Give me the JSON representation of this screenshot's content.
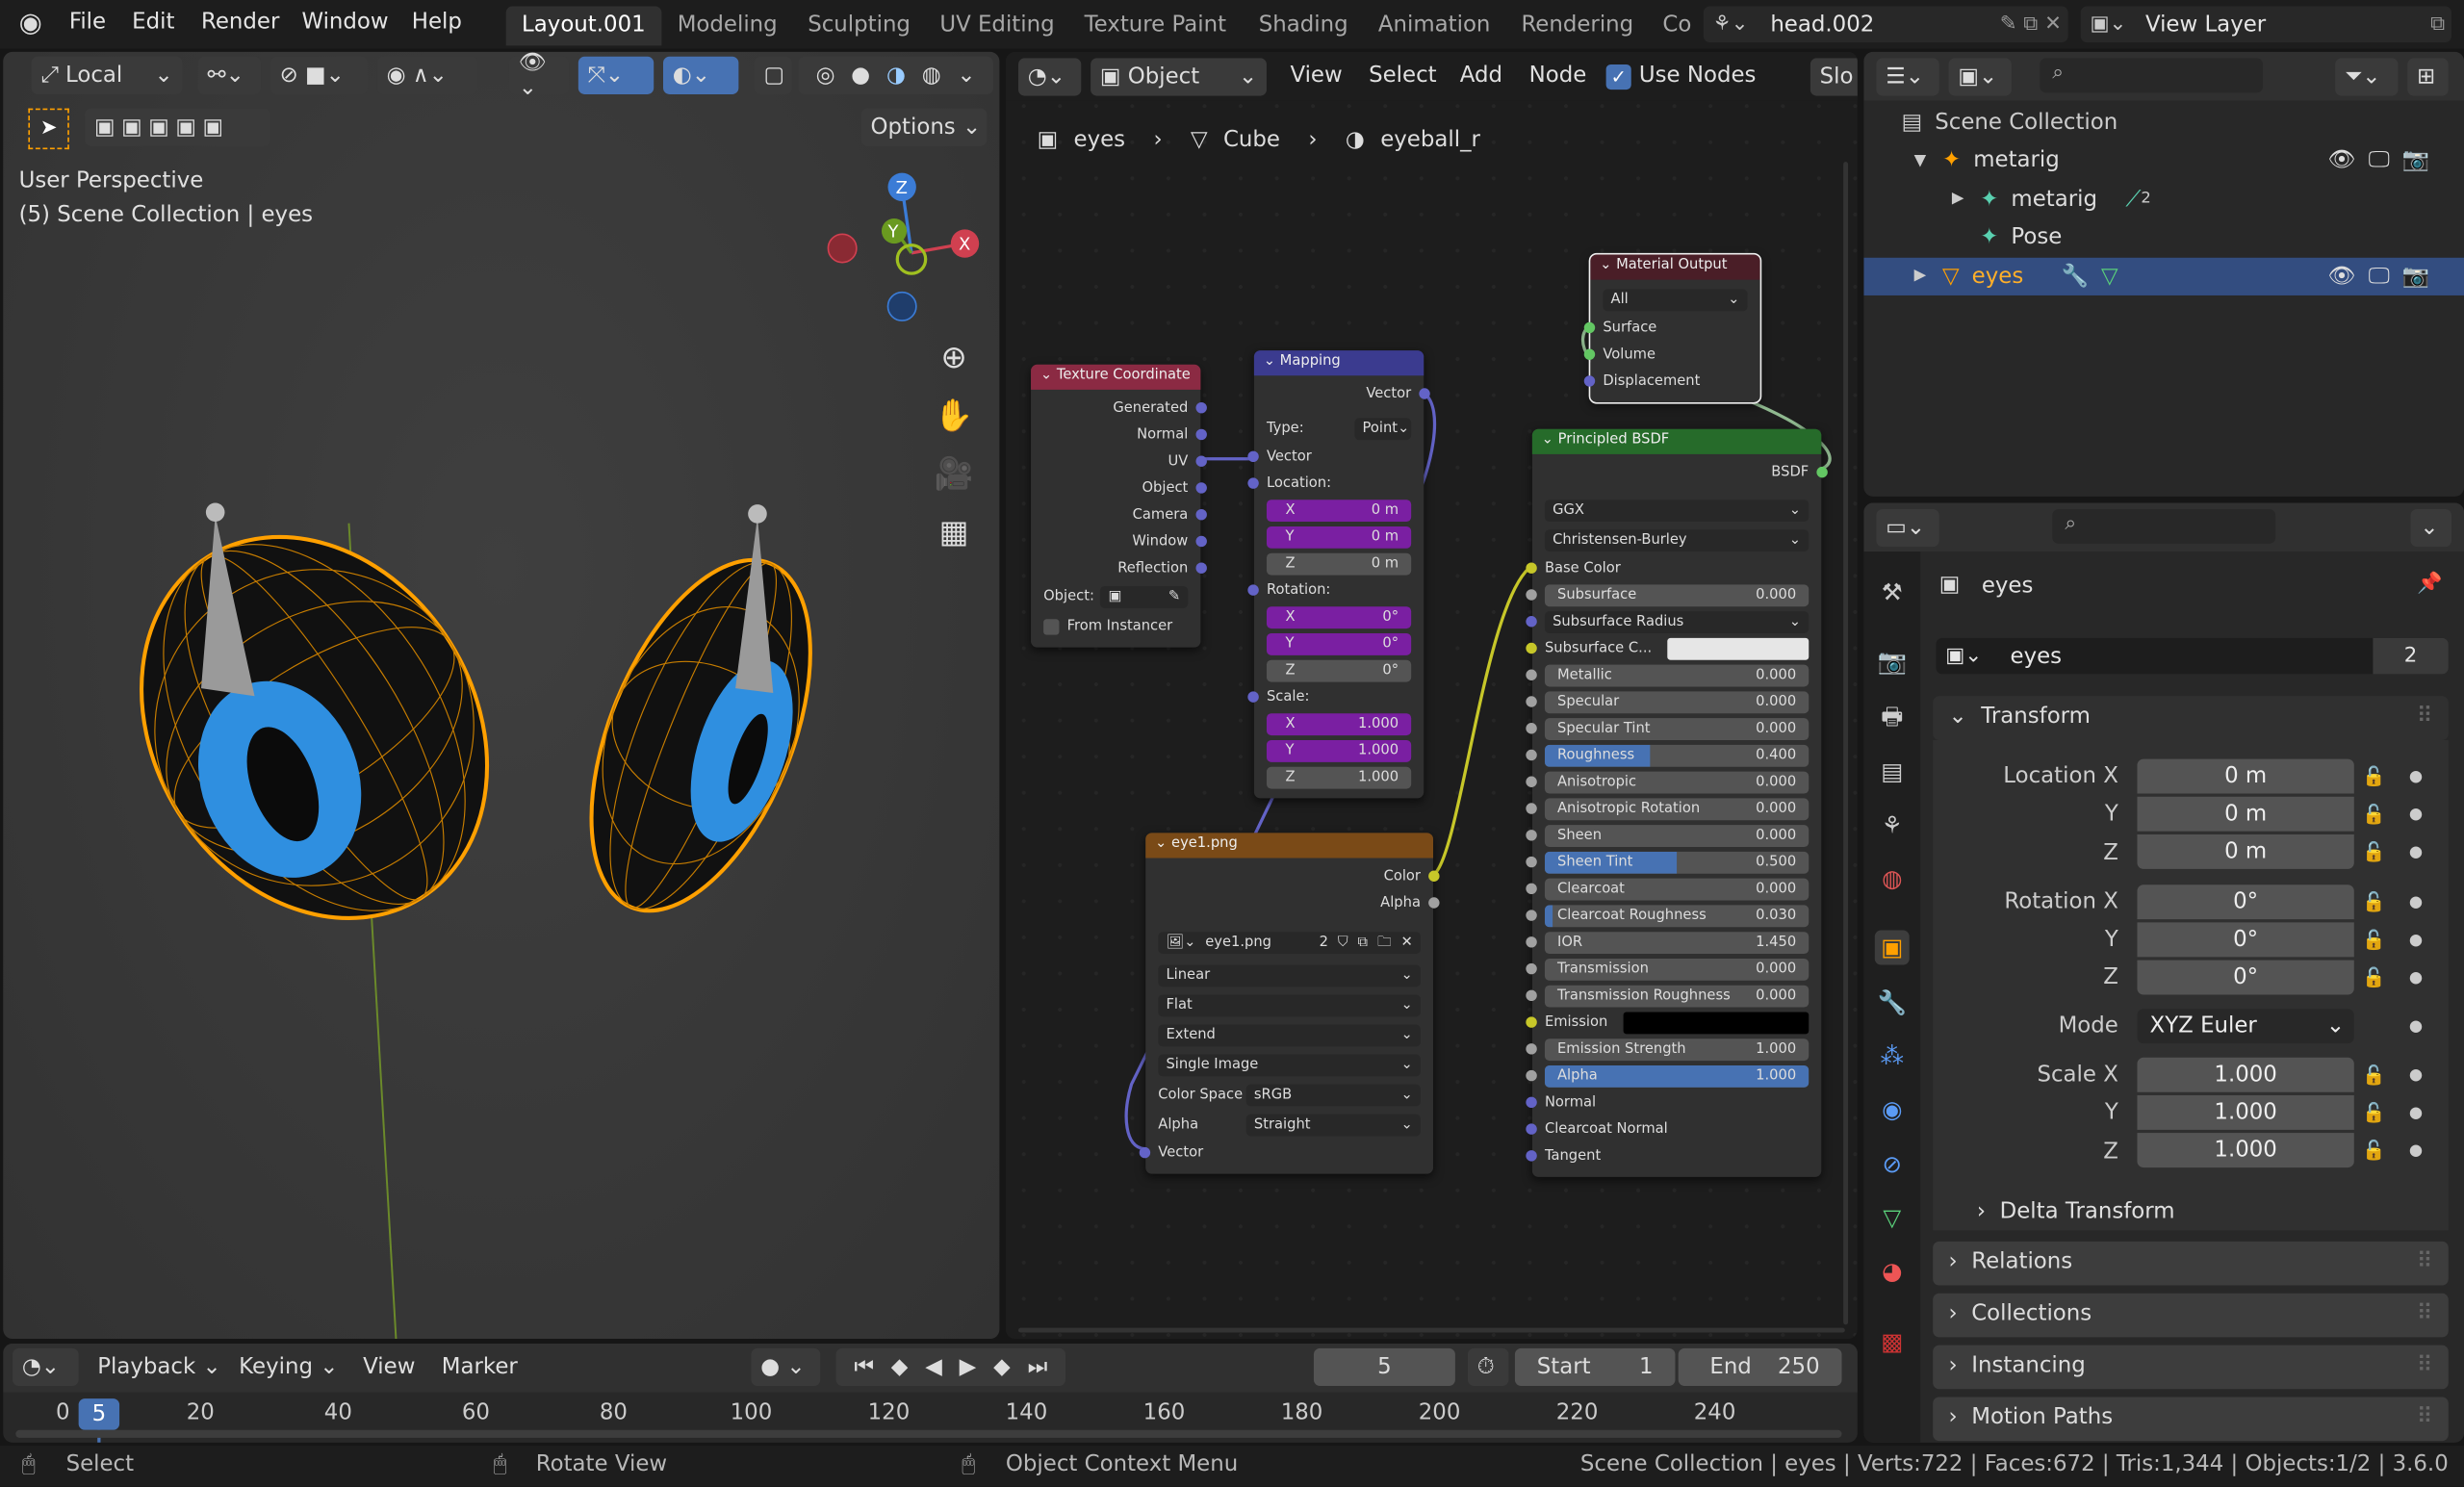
{
  "topbar": {
    "menus": [
      "File",
      "Edit",
      "Render",
      "Window",
      "Help"
    ],
    "workspaces": [
      "Layout.001",
      "Modeling",
      "Sculpting",
      "UV Editing",
      "Texture Paint",
      "Shading",
      "Animation",
      "Rendering",
      "Co"
    ],
    "active_workspace": "Layout.001",
    "scene": "head.002",
    "view_layer": "View Layer"
  },
  "viewport": {
    "orientation": "Local",
    "options": "Options",
    "view_name": "User Perspective",
    "context": "(5) Scene Collection | eyes",
    "gizmo": {
      "x": "X",
      "y": "Y",
      "z": "Z"
    }
  },
  "node_editor": {
    "object_mode": "Object",
    "menus": [
      "View",
      "Select",
      "Add",
      "Node"
    ],
    "use_nodes": "Use Nodes",
    "use_nodes_checked": true,
    "slot": "Slo",
    "breadcrumb": [
      "eyes",
      "Cube",
      "eyeball_r"
    ]
  },
  "nodes": {
    "texcoord": {
      "title": "Texture Coordinate",
      "color": "#8b2a43",
      "rows": [
        {
          "t": "out",
          "label": "Generated",
          "s": "#6363c7"
        },
        {
          "t": "out",
          "label": "Normal",
          "s": "#6363c7"
        },
        {
          "t": "out",
          "label": "UV",
          "s": "#6363c7"
        },
        {
          "t": "out",
          "label": "Object",
          "s": "#6363c7"
        },
        {
          "t": "out",
          "label": "Camera",
          "s": "#6363c7"
        },
        {
          "t": "out",
          "label": "Window",
          "s": "#6363c7"
        },
        {
          "t": "out",
          "label": "Reflection",
          "s": "#6363c7"
        },
        {
          "t": "objfield",
          "label": "Object:"
        },
        {
          "t": "check",
          "label": "From Instancer"
        }
      ]
    },
    "mapping": {
      "title": "Mapping",
      "color": "#3b3b8f",
      "rows": [
        {
          "t": "out",
          "label": "Vector",
          "s": "#6363c7"
        },
        {
          "t": "propsel",
          "label": "Type:",
          "value": "Point"
        },
        {
          "t": "in",
          "label": "Vector",
          "s": "#6363c7"
        },
        {
          "t": "in",
          "label": "Location:",
          "s": "#6363c7"
        },
        {
          "t": "vec",
          "label": "X",
          "value": "0 m"
        },
        {
          "t": "vec",
          "label": "Y",
          "value": "0 m"
        },
        {
          "t": "vecg",
          "label": "Z",
          "value": "0 m"
        },
        {
          "t": "in",
          "label": "Rotation:",
          "s": "#6363c7"
        },
        {
          "t": "vec",
          "label": "X",
          "value": "0°"
        },
        {
          "t": "vec",
          "label": "Y",
          "value": "0°"
        },
        {
          "t": "vecg",
          "label": "Z",
          "value": "0°"
        },
        {
          "t": "in",
          "label": "Scale:",
          "s": "#6363c7"
        },
        {
          "t": "vec",
          "label": "X",
          "value": "1.000"
        },
        {
          "t": "vec",
          "label": "Y",
          "value": "1.000"
        },
        {
          "t": "vecg",
          "label": "Z",
          "value": "1.000"
        }
      ]
    },
    "output": {
      "title": "Material Output",
      "color": "#4a1e27",
      "rows": [
        {
          "t": "sel",
          "value": "All"
        },
        {
          "t": "in",
          "label": "Surface",
          "s": "#63c763"
        },
        {
          "t": "in",
          "label": "Volume",
          "s": "#63c763"
        },
        {
          "t": "in",
          "label": "Displacement",
          "s": "#6363c7"
        }
      ]
    },
    "bsdf": {
      "title": "Principled BSDF",
      "color": "#266b2a",
      "rows": [
        {
          "t": "out",
          "label": "BSDF",
          "s": "#63c763"
        },
        {
          "t": "sel",
          "value": "GGX"
        },
        {
          "t": "sel",
          "value": "Christensen-Burley"
        },
        {
          "t": "in",
          "label": "Base Color",
          "s": "#c7c729"
        },
        {
          "t": "slider",
          "label": "Subsurface",
          "value": "0.000",
          "f": 0,
          "s": "#a1a1a1"
        },
        {
          "t": "selin",
          "label": "Subsurface Radius",
          "s": "#6363c7"
        },
        {
          "t": "color",
          "label": "Subsurface C...",
          "color": "#e6e6e6",
          "s": "#c7c729"
        },
        {
          "t": "slider",
          "label": "Metallic",
          "value": "0.000",
          "f": 0,
          "s": "#a1a1a1"
        },
        {
          "t": "slider",
          "label": "Specular",
          "value": "0.000",
          "f": 0,
          "s": "#a1a1a1"
        },
        {
          "t": "slider",
          "label": "Specular Tint",
          "value": "0.000",
          "f": 0,
          "s": "#a1a1a1"
        },
        {
          "t": "slider",
          "label": "Roughness",
          "value": "0.400",
          "f": 0.4,
          "s": "#a1a1a1"
        },
        {
          "t": "slider",
          "label": "Anisotropic",
          "value": "0.000",
          "f": 0,
          "s": "#a1a1a1"
        },
        {
          "t": "slider",
          "label": "Anisotropic Rotation",
          "value": "0.000",
          "f": 0,
          "s": "#a1a1a1"
        },
        {
          "t": "slider",
          "label": "Sheen",
          "value": "0.000",
          "f": 0,
          "s": "#a1a1a1"
        },
        {
          "t": "slider",
          "label": "Sheen Tint",
          "value": "0.500",
          "f": 0.5,
          "s": "#a1a1a1"
        },
        {
          "t": "slider",
          "label": "Clearcoat",
          "value": "0.000",
          "f": 0,
          "s": "#a1a1a1"
        },
        {
          "t": "slider",
          "label": "Clearcoat Roughness",
          "value": "0.030",
          "f": 0.03,
          "s": "#a1a1a1"
        },
        {
          "t": "slider",
          "label": "IOR",
          "value": "1.450",
          "f": 0,
          "s": "#a1a1a1"
        },
        {
          "t": "slider",
          "label": "Transmission",
          "value": "0.000",
          "f": 0,
          "s": "#a1a1a1"
        },
        {
          "t": "slider",
          "label": "Transmission Roughness",
          "value": "0.000",
          "f": 0,
          "s": "#a1a1a1"
        },
        {
          "t": "color",
          "label": "Emission",
          "color": "#000000",
          "s": "#c7c729"
        },
        {
          "t": "slider",
          "label": "Emission Strength",
          "value": "1.000",
          "f": 0,
          "s": "#a1a1a1"
        },
        {
          "t": "slider",
          "label": "Alpha",
          "value": "1.000",
          "f": 1,
          "s": "#a1a1a1"
        },
        {
          "t": "in",
          "label": "Normal",
          "s": "#6363c7"
        },
        {
          "t": "in",
          "label": "Clearcoat Normal",
          "s": "#6363c7"
        },
        {
          "t": "in",
          "label": "Tangent",
          "s": "#6363c7"
        }
      ]
    },
    "image": {
      "title": "eye1.png",
      "color": "#7a4a17",
      "rows": [
        {
          "t": "out",
          "label": "Color",
          "s": "#c7c729"
        },
        {
          "t": "out",
          "label": "Alpha",
          "s": "#a1a1a1"
        },
        {
          "t": "imgfield",
          "value": "eye1.png",
          "users": "2"
        },
        {
          "t": "sel",
          "value": "Linear"
        },
        {
          "t": "sel",
          "value": "Flat"
        },
        {
          "t": "sel",
          "value": "Extend"
        },
        {
          "t": "sel",
          "value": "Single Image"
        },
        {
          "t": "propsel",
          "label": "Color Space",
          "value": "sRGB"
        },
        {
          "t": "propsel",
          "label": "Alpha",
          "value": "Straight"
        },
        {
          "t": "in",
          "label": "Vector",
          "s": "#6363c7"
        }
      ]
    }
  },
  "outliner": {
    "root": "Scene Collection",
    "items": [
      {
        "label": "metarig",
        "depth": 0,
        "icon": "armature-icon"
      },
      {
        "label": "metarig",
        "depth": 1,
        "icon": "armature-data-icon",
        "badge": "2"
      },
      {
        "label": "Pose",
        "depth": 1,
        "icon": "pose-icon"
      },
      {
        "label": "eyes",
        "depth": 0,
        "icon": "mesh-object-icon",
        "selected": true
      }
    ]
  },
  "properties": {
    "object_name": "eyes",
    "datablock": "eyes",
    "users": "2",
    "transform_title": "Transform",
    "location": {
      "label": "Location X",
      "x": "0 m",
      "y": "0 m",
      "z": "0 m"
    },
    "rotation": {
      "label": "Rotation X",
      "x": "0°",
      "y": "0°",
      "z": "0°"
    },
    "mode": {
      "label": "Mode",
      "value": "XYZ Euler"
    },
    "scale": {
      "label": "Scale X",
      "x": "1.000",
      "y": "1.000",
      "z": "1.000"
    },
    "axis": {
      "y": "Y",
      "z": "Z"
    },
    "sub_panels": [
      "Delta Transform",
      "Relations",
      "Collections",
      "Instancing",
      "Motion Paths"
    ]
  },
  "timeline": {
    "menus": [
      "Playback",
      "Keying",
      "View",
      "Marker"
    ],
    "current_frame": "5",
    "start_label": "Start",
    "start": "1",
    "end_label": "End",
    "end": "250",
    "ticks": [
      "0",
      "20",
      "40",
      "60",
      "80",
      "100",
      "120",
      "140",
      "160",
      "180",
      "200",
      "220",
      "240"
    ]
  },
  "status": {
    "select": "Select",
    "rotate": "Rotate View",
    "context_menu": "Object Context Menu",
    "stats": "Scene Collection | eyes | Verts:722 | Faces:672 | Tris:1,344 | Objects:1/2 | 3.6.0"
  },
  "colors": {
    "accent": "#4772b3",
    "selection": "#334d80",
    "object_orange": "#ffa000"
  }
}
